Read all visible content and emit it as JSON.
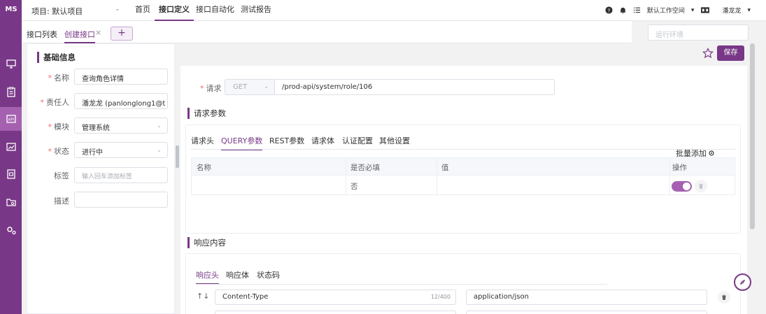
{
  "app": {
    "logo_text": "MS"
  },
  "header": {
    "project": "项目: 默认项目",
    "nav": [
      "首页",
      "接口定义",
      "接口自动化",
      "测试报告"
    ],
    "workspace": "默认工作空间",
    "user": "潘龙龙"
  },
  "tabs": {
    "list": "接口列表",
    "create": "创建接口",
    "close_symbol": "×",
    "add_symbol": "+"
  },
  "environment": {
    "placeholder": "运行环境"
  },
  "basic": {
    "title": "基础信息",
    "fields": [
      {
        "label": "名称",
        "required": "*",
        "value": "查询角色详情"
      },
      {
        "label": "责任人",
        "required": "*",
        "value": "潘龙龙 (panlonglong1@t"
      },
      {
        "label": "模块",
        "required": "*",
        "value": "管理系统"
      },
      {
        "label": "状态",
        "required": "*",
        "value": "进行中"
      },
      {
        "label": "标签",
        "required": "",
        "placeholder": "输入回车添加标签"
      },
      {
        "label": "描述",
        "required": "",
        "value": ""
      }
    ]
  },
  "toolbar": {
    "save": "保存"
  },
  "request": {
    "label": "请求",
    "required": "*",
    "method": "GET",
    "url": "/prod-api/system/role/106"
  },
  "params": {
    "title": "请求参数",
    "tabs": [
      "请求头",
      "QUERY参数",
      "REST参数",
      "请求体",
      "认证配置",
      "其他设置"
    ],
    "active_tab": 1,
    "batch_add": "批量添加",
    "columns": [
      "名称",
      "是否必填",
      "值",
      "操作"
    ],
    "rows": [
      {
        "name": "",
        "required": "否",
        "value": "",
        "enabled": true
      }
    ]
  },
  "response": {
    "title": "响应内容",
    "tabs": [
      "响应头",
      "响应体",
      "状态码"
    ],
    "active_tab": 0,
    "row": {
      "sort_symbol": "↑↓",
      "key": "Content-Type",
      "count": "12/400",
      "value": "application/json"
    }
  },
  "colors": {
    "accent": "#783887",
    "accent_light": "#a561b0",
    "required": "#f56c6c"
  }
}
